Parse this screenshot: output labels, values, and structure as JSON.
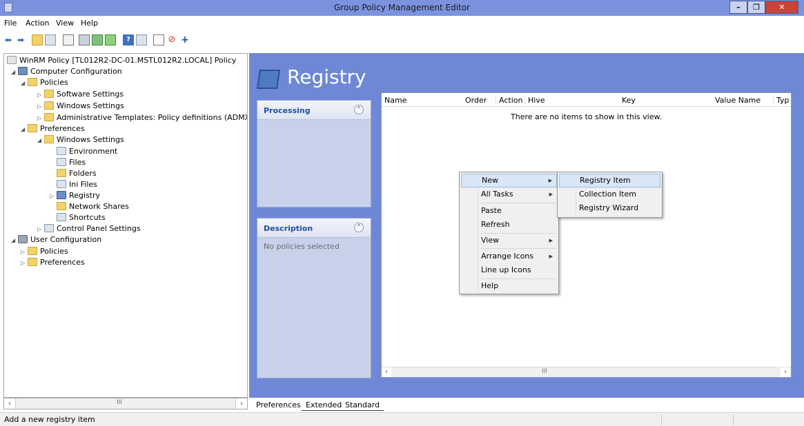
{
  "window": {
    "title": "Group Policy Management Editor",
    "min": "–",
    "max": "❐",
    "close": "✕"
  },
  "menu": {
    "file": "File",
    "action": "Action",
    "view": "View",
    "help": "Help"
  },
  "tree": {
    "root": "WinRM Policy [TL012R2-DC-01.MSTL012R2.LOCAL] Policy",
    "computer_config": "Computer Configuration",
    "policies": "Policies",
    "software_settings": "Software Settings",
    "windows_settings": "Windows Settings",
    "admin_templates": "Administrative Templates: Policy definitions (ADMX files)",
    "preferences": "Preferences",
    "pref_windows_settings": "Windows Settings",
    "environment": "Environment",
    "files": "Files",
    "folders": "Folders",
    "ini_files": "Ini Files",
    "registry": "Registry",
    "network_shares": "Network Shares",
    "shortcuts": "Shortcuts",
    "control_panel": "Control Panel Settings",
    "user_config": "User Configuration",
    "user_policies": "Policies",
    "user_preferences": "Preferences"
  },
  "content": {
    "heading": "Registry",
    "processing": "Processing",
    "description": "Description",
    "no_policies": "No policies selected",
    "columns": [
      "Name",
      "Order",
      "Action",
      "Hive",
      "Key",
      "Value Name",
      "Typ"
    ],
    "empty_message": "There are no items to show in this view.",
    "scroll_mark": "III"
  },
  "left_scroll_mark": "III",
  "context_menu": {
    "new": "New",
    "all_tasks": "All Tasks",
    "paste": "Paste",
    "refresh": "Refresh",
    "view": "View",
    "arrange_icons": "Arrange Icons",
    "line_up_icons": "Line up Icons",
    "help": "Help"
  },
  "submenu": {
    "registry_item": "Registry Item",
    "collection_item": "Collection Item",
    "registry_wizard": "Registry Wizard"
  },
  "tabs": {
    "preferences": "Preferences",
    "extended": "Extended",
    "standard": "Standard"
  },
  "status": {
    "text": "Add a new registry item"
  }
}
